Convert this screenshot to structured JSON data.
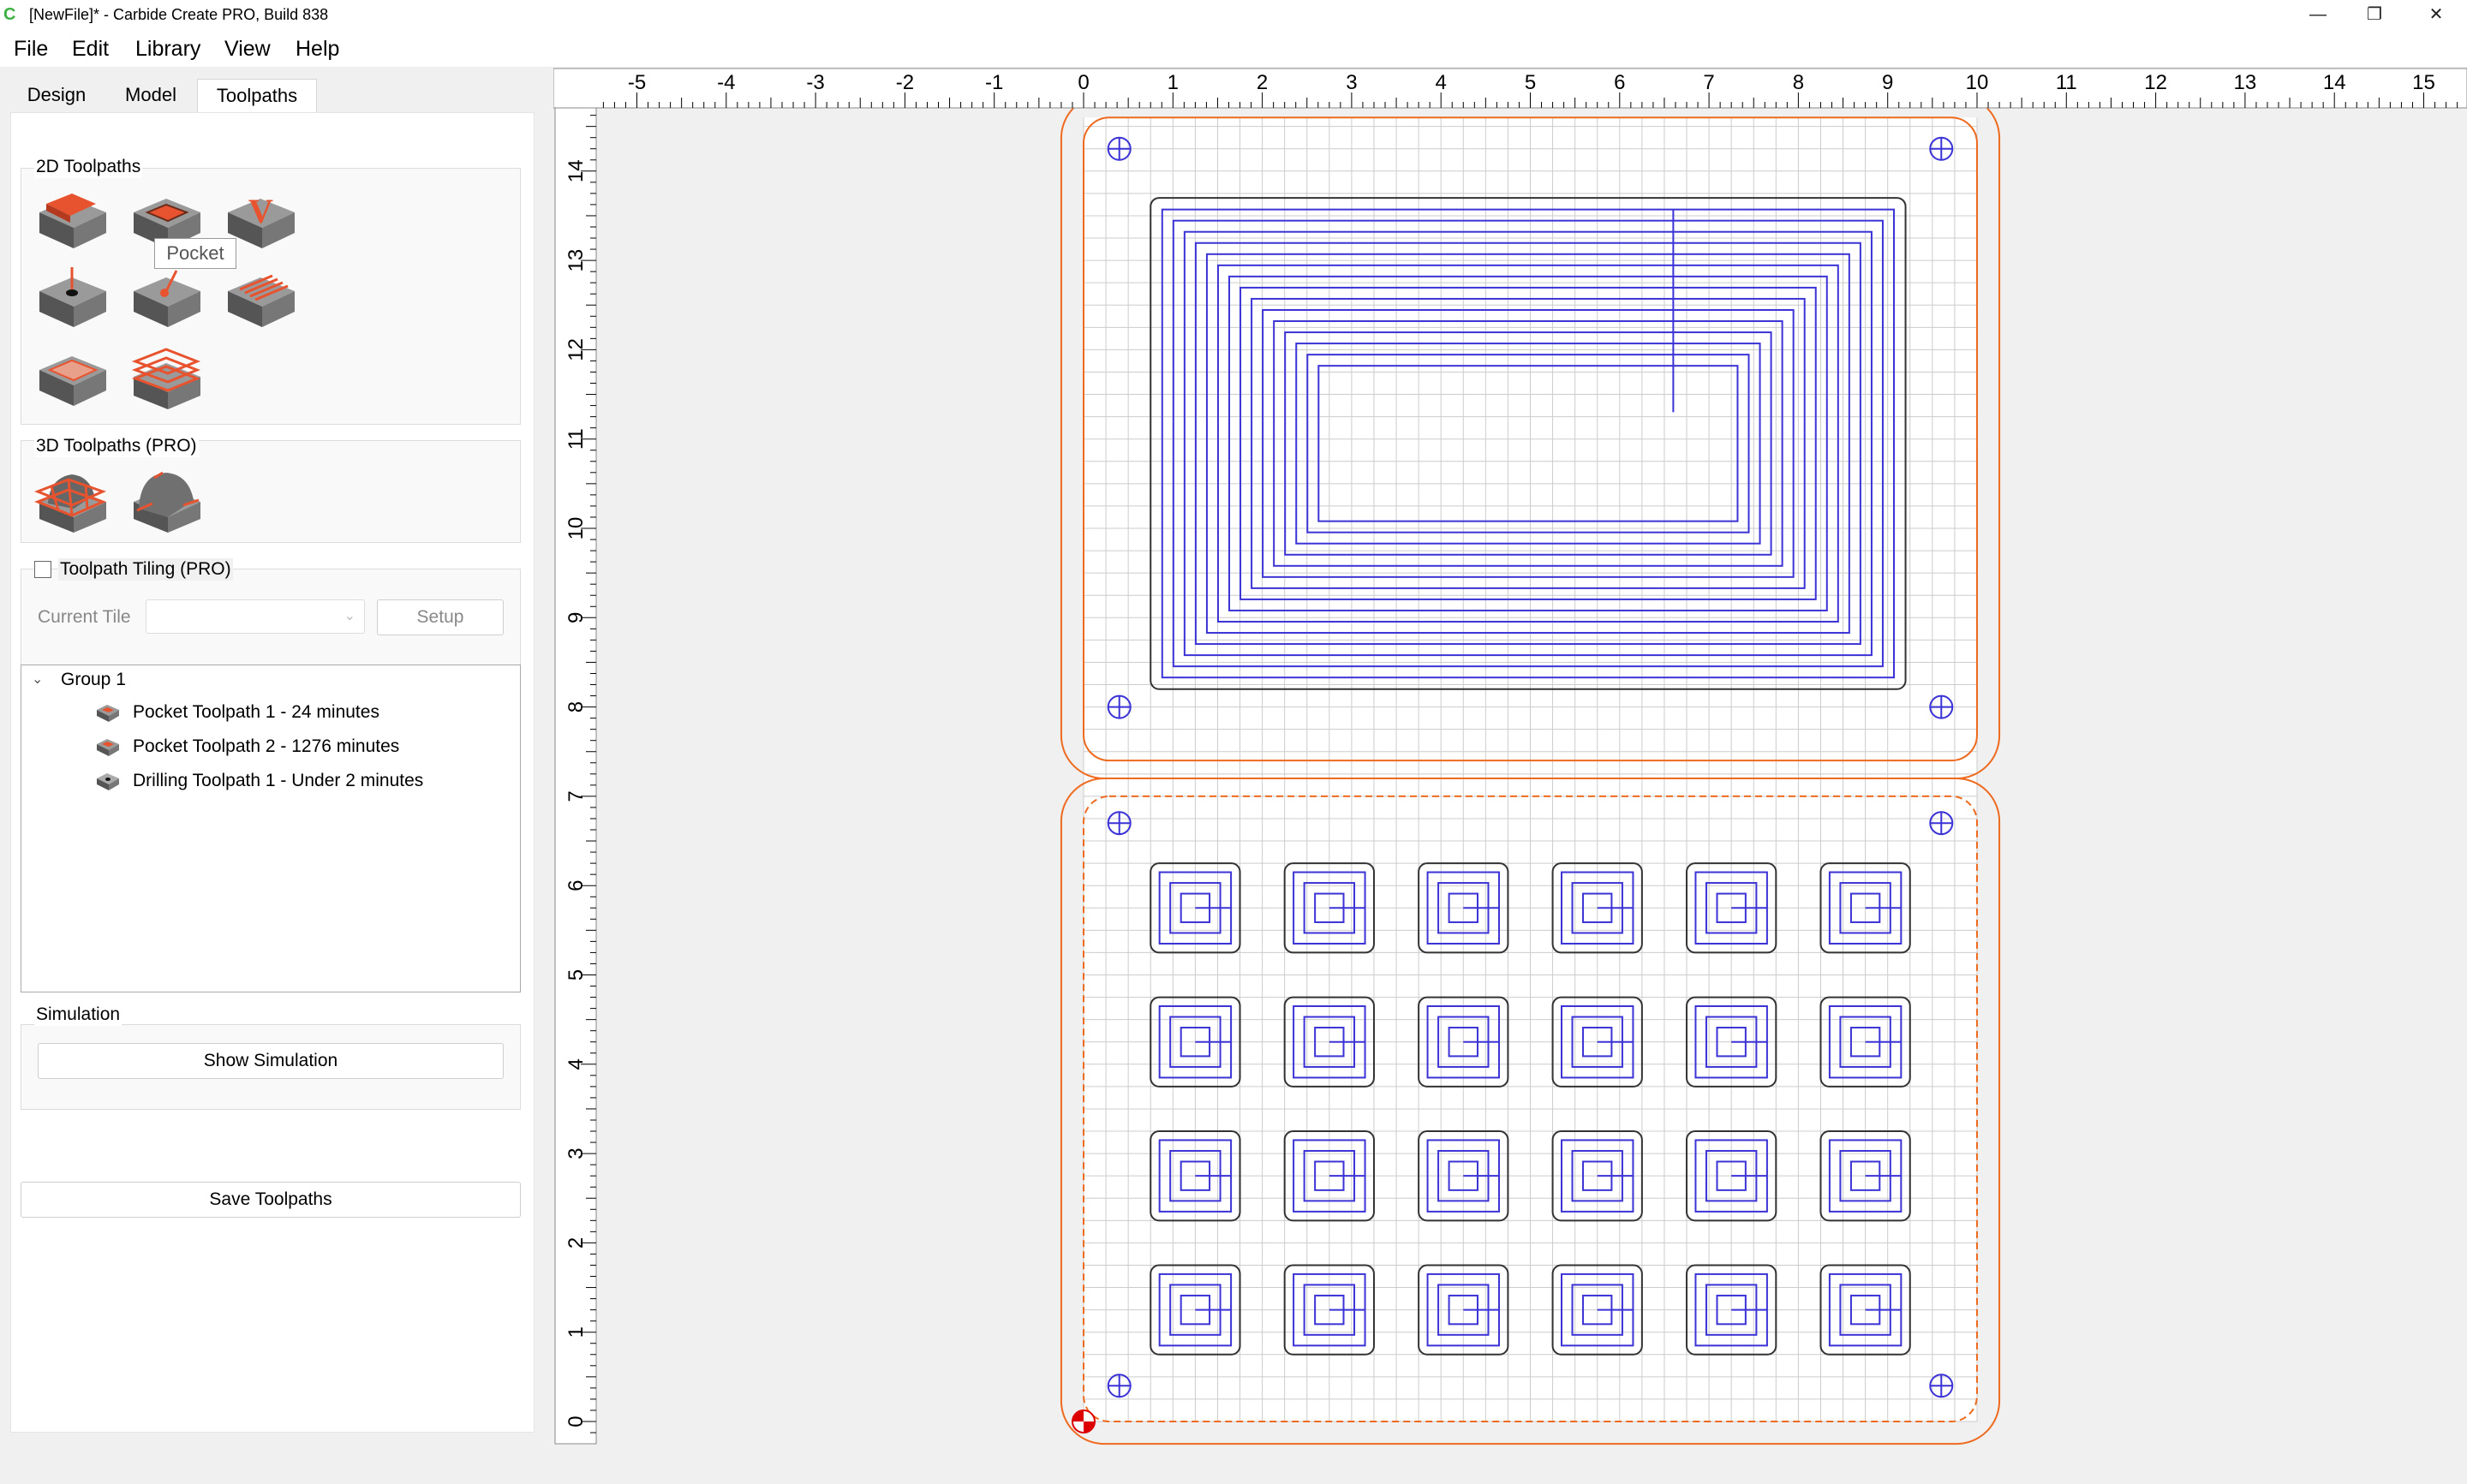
{
  "window": {
    "title": "[NewFile]* - Carbide Create PRO, Build 838",
    "app_icon": "C",
    "minimize": "—",
    "maximize": "❐",
    "close": "✕"
  },
  "menu": [
    "File",
    "Edit",
    "Library",
    "View",
    "Help"
  ],
  "tabs": [
    "Design",
    "Model",
    "Toolpaths"
  ],
  "toolpaths_2d": {
    "label": "2D Toolpaths",
    "icons": [
      "contour-toolpath-icon",
      "pocket-toolpath-icon",
      "vcarve-toolpath-icon",
      "drill-toolpath-icon",
      "advanced-vcarve-icon",
      "texture-toolpath-icon",
      "rough-pocket-icon",
      "adaptive-toolpath-icon"
    ],
    "tooltip": "Pocket"
  },
  "toolpaths_3d": {
    "label": "3D Toolpaths (PRO)",
    "icons": [
      "3d-rough-icon",
      "3d-finish-icon"
    ]
  },
  "tiling": {
    "label": "Toolpath Tiling (PRO)",
    "checked": false,
    "current_tile_label": "Current Tile",
    "current_tile_value": "",
    "setup_label": "Setup"
  },
  "tree": {
    "group": "Group 1",
    "items": [
      {
        "label": "Pocket Toolpath 1 - 24 minutes",
        "type": "pocket"
      },
      {
        "label": "Pocket Toolpath 2 - 1276 minutes",
        "type": "pocket"
      },
      {
        "label": "Drilling Toolpath 1 - Under 2 minutes",
        "type": "drill"
      }
    ]
  },
  "simulation": {
    "label": "Simulation",
    "show_label": "Show Simulation"
  },
  "save_label": "Save Toolpaths",
  "ruler": {
    "x_ticks": [
      "-5",
      "-4",
      "-3",
      "-2",
      "-1",
      "0",
      "1",
      "2",
      "3",
      "4",
      "5",
      "6",
      "7",
      "8",
      "9",
      "10",
      "11",
      "12",
      "13",
      "14",
      "15"
    ],
    "y_ticks": [
      "0",
      "1",
      "2",
      "3",
      "4",
      "5",
      "6",
      "7",
      "8",
      "9",
      "10",
      "11",
      "12",
      "13",
      "14"
    ]
  },
  "colors": {
    "toolpath": "#3b33d6",
    "outline": "#ee6a1f",
    "grid": "#cccccc",
    "accent": "#e8532f"
  }
}
